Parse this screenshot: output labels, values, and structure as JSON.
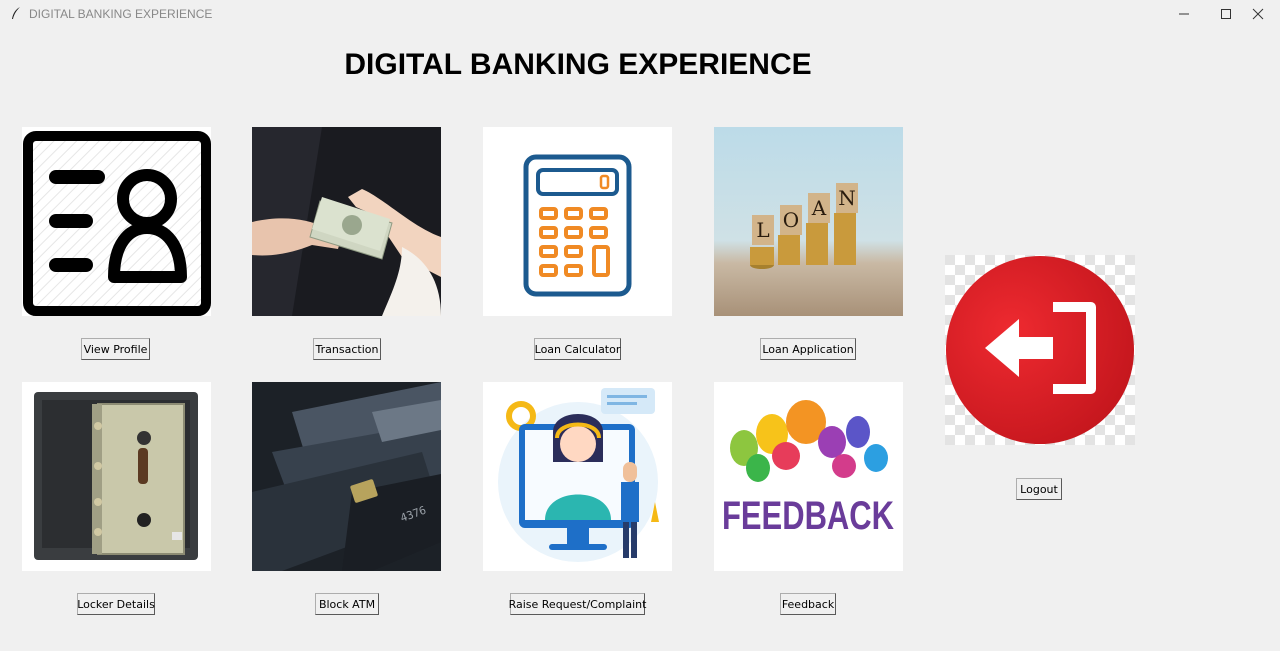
{
  "window": {
    "title": "DIGITAL BANKING EXPERIENCE"
  },
  "heading": "DIGITAL BANKING EXPERIENCE",
  "buttons": {
    "view_profile": "View Profile",
    "transaction": "Transaction",
    "loan_calculator": "Loan Calculator",
    "loan_application": "Loan Application",
    "locker_details": "Locker Details",
    "block_atm": "Block ATM",
    "raise_request": "Raise Request/Complaint",
    "feedback": "Feedback",
    "logout": "Logout"
  },
  "images": {
    "loan_letters": [
      "L",
      "O",
      "A",
      "N"
    ],
    "feedback_word": "FEEDBACK"
  },
  "colors": {
    "window_bg": "#f0f0f0",
    "logout_red": "#e31b23",
    "calculator_blue": "#1c5a8f",
    "calculator_orange": "#f08a24"
  }
}
